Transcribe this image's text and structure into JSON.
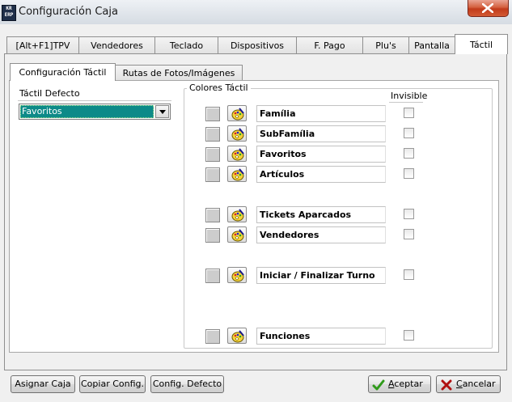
{
  "window": {
    "title": "Configuración Caja",
    "app_icon_text": "KR ERP",
    "close_label": "Close"
  },
  "tabs": [
    {
      "label": "[Alt+F1]TPV"
    },
    {
      "label": "Vendedores"
    },
    {
      "label": "Teclado"
    },
    {
      "label": "Dispositivos"
    },
    {
      "label": "F. Pago"
    },
    {
      "label": "Plu's"
    },
    {
      "label": "Pantalla"
    },
    {
      "label": "Táctil",
      "active": true
    }
  ],
  "subtabs": [
    {
      "label": "Configuración Táctil",
      "active": true
    },
    {
      "label": "Rutas de Fotos/Imágenes"
    }
  ],
  "tactil_defecto": {
    "label": "Táctil Defecto",
    "selected": "Favoritos"
  },
  "colores": {
    "label": "Colores Táctil",
    "invisible_header": "Invisible",
    "rows": [
      {
        "name": "Família",
        "invisible": false
      },
      {
        "name": "SubFamília",
        "invisible": false
      },
      {
        "name": "Favoritos",
        "invisible": false
      },
      {
        "name": "Artículos",
        "invisible": false
      },
      {
        "name": "Tickets Aparcados",
        "invisible": false
      },
      {
        "name": "Vendedores",
        "invisible": false
      },
      {
        "name": "Iniciar / Finalizar Turno",
        "invisible": false
      },
      {
        "name": "Funciones",
        "invisible": false
      }
    ]
  },
  "buttons": {
    "asignar_caja": "Asignar Caja",
    "copiar_config": "Copiar Config.",
    "config_defecto": "Config. Defecto",
    "aceptar_first": "A",
    "aceptar_rest": "ceptar",
    "cancelar_first": "C",
    "cancelar_rest": "ancelar"
  },
  "colors": {
    "selection": "#0d8a88",
    "accept_icon": "#2f9a1a",
    "cancel_icon": "#b01010",
    "close_button": "#c94a2a"
  }
}
